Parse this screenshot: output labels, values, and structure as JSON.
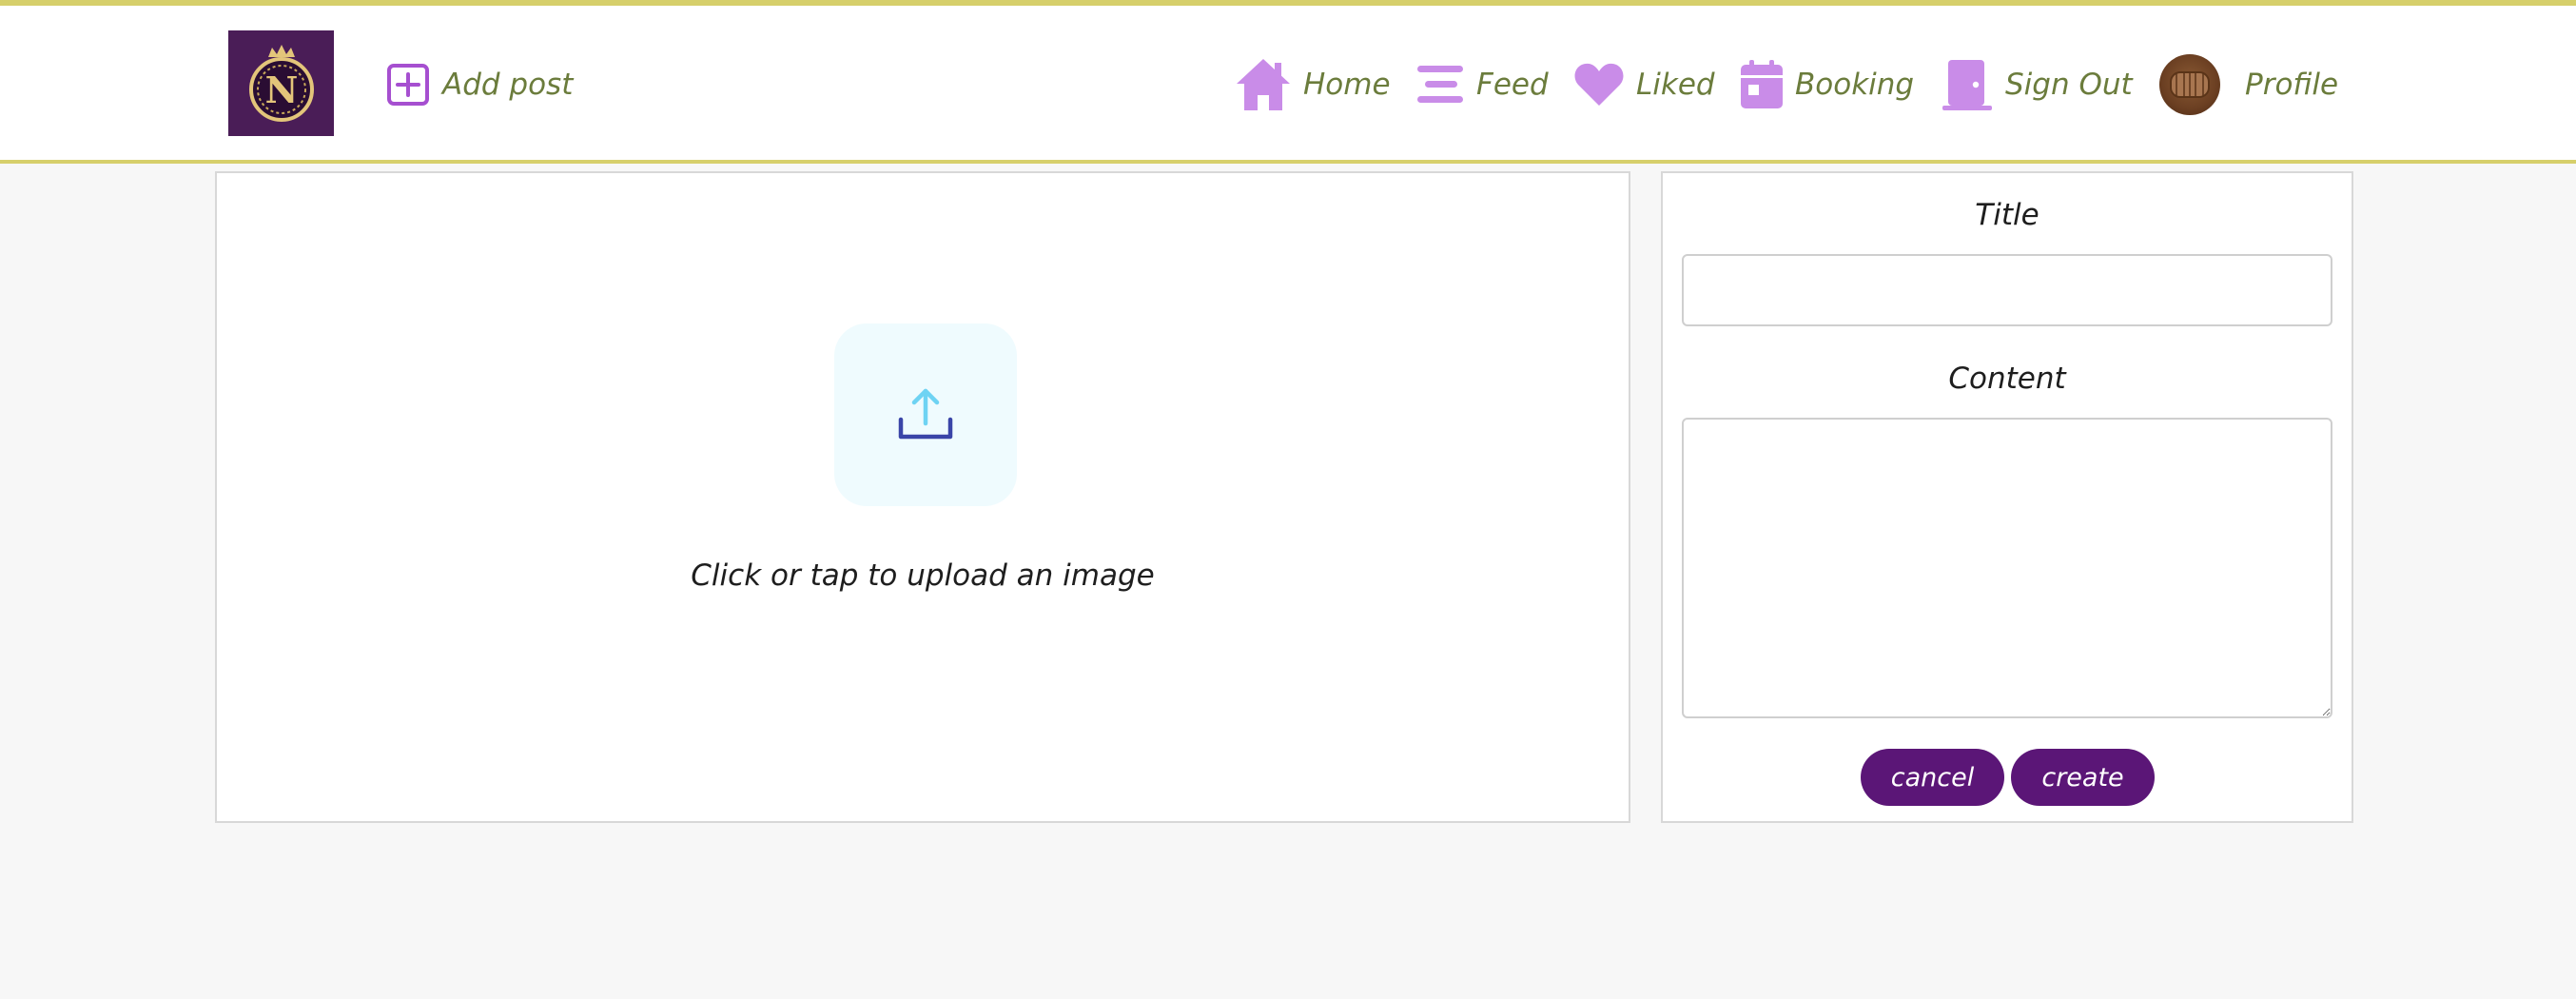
{
  "nav": {
    "add_post_label": "Add post",
    "links": [
      {
        "label": "Home",
        "icon": "home-icon"
      },
      {
        "label": "Feed",
        "icon": "feed-icon"
      },
      {
        "label": "Liked",
        "icon": "heart-icon"
      },
      {
        "label": "Booking",
        "icon": "calendar-icon"
      },
      {
        "label": "Sign Out",
        "icon": "door-icon"
      },
      {
        "label": "Profile",
        "icon": "avatar"
      }
    ],
    "logo_letter": "N"
  },
  "upload": {
    "prompt": "Click or tap to upload an image"
  },
  "form": {
    "title_label": "Title",
    "title_value": "",
    "content_label": "Content",
    "content_value": "",
    "cancel_label": "cancel",
    "create_label": "create"
  },
  "colors": {
    "accent_purple": "#5b1677",
    "icon_lilac": "#c98ce8",
    "nav_text": "#6b7c3c",
    "border_gold": "#d6cf6b"
  }
}
